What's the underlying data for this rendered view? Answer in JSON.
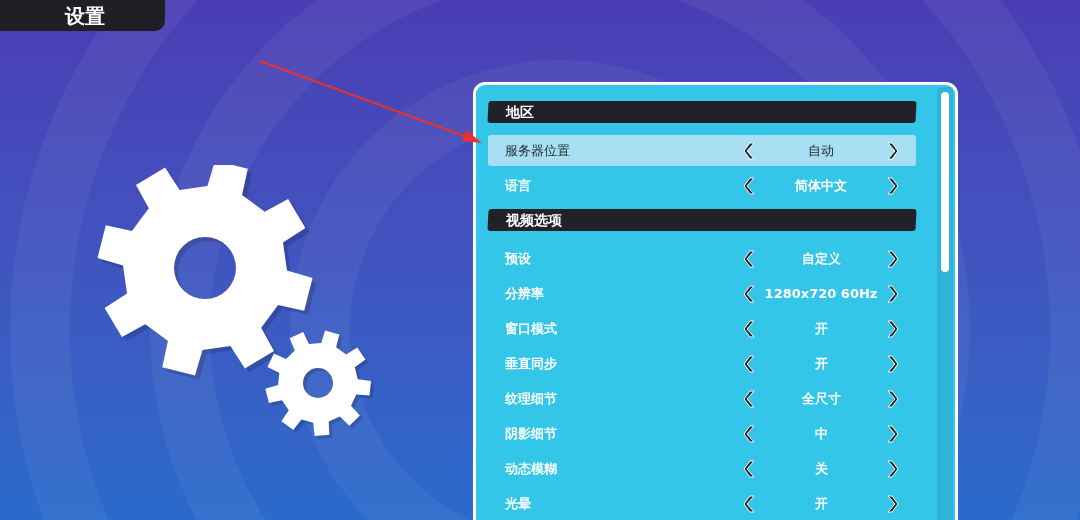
{
  "title": "设置",
  "sections": [
    {
      "title": "地区",
      "rows": [
        {
          "label": "服务器位置",
          "value": "自动",
          "selected": true
        },
        {
          "label": "语言",
          "value": "简体中文",
          "selected": false
        }
      ]
    },
    {
      "title": "视频选项",
      "rows": [
        {
          "label": "预设",
          "value": "自定义",
          "selected": false
        },
        {
          "label": "分辨率",
          "value": "1280x720 60Hz",
          "selected": false
        },
        {
          "label": "窗口模式",
          "value": "开",
          "selected": false
        },
        {
          "label": "垂直同步",
          "value": "开",
          "selected": false
        },
        {
          "label": "纹理细节",
          "value": "全尺寸",
          "selected": false
        },
        {
          "label": "阴影细节",
          "value": "中",
          "selected": false
        },
        {
          "label": "动态模糊",
          "value": "关",
          "selected": false
        },
        {
          "label": "光晕",
          "value": "开",
          "selected": false
        }
      ]
    }
  ]
}
